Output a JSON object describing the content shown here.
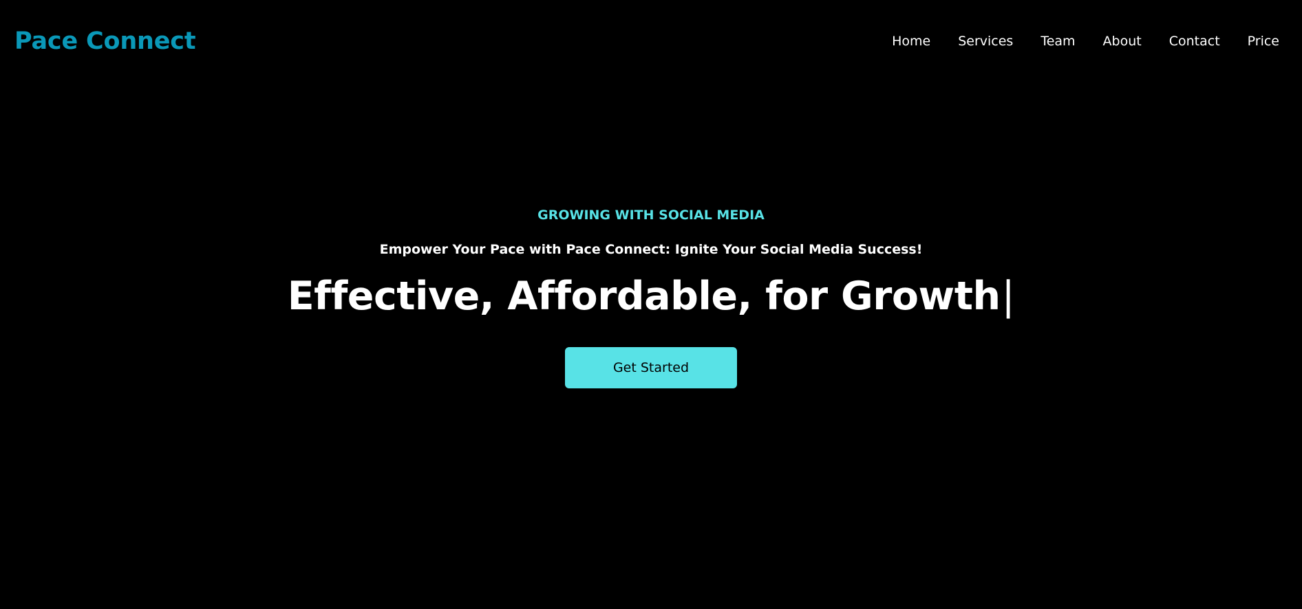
{
  "colors": {
    "background": "#000000",
    "brand": "#0a98b8",
    "accent": "#58e2e6",
    "text": "#ffffff",
    "button_text": "#000000"
  },
  "header": {
    "brand": "Pace Connect",
    "nav": [
      "Home",
      "Services",
      "Team",
      "About",
      "Contact",
      "Price"
    ]
  },
  "hero": {
    "eyebrow": "GROWING WITH SOCIAL MEDIA",
    "tagline": "Empower Your Pace with Pace Connect: Ignite Your Social Media Success!",
    "headline": "Effective, Affordable, for Growth",
    "cursor": "|",
    "cta_label": "Get Started"
  }
}
